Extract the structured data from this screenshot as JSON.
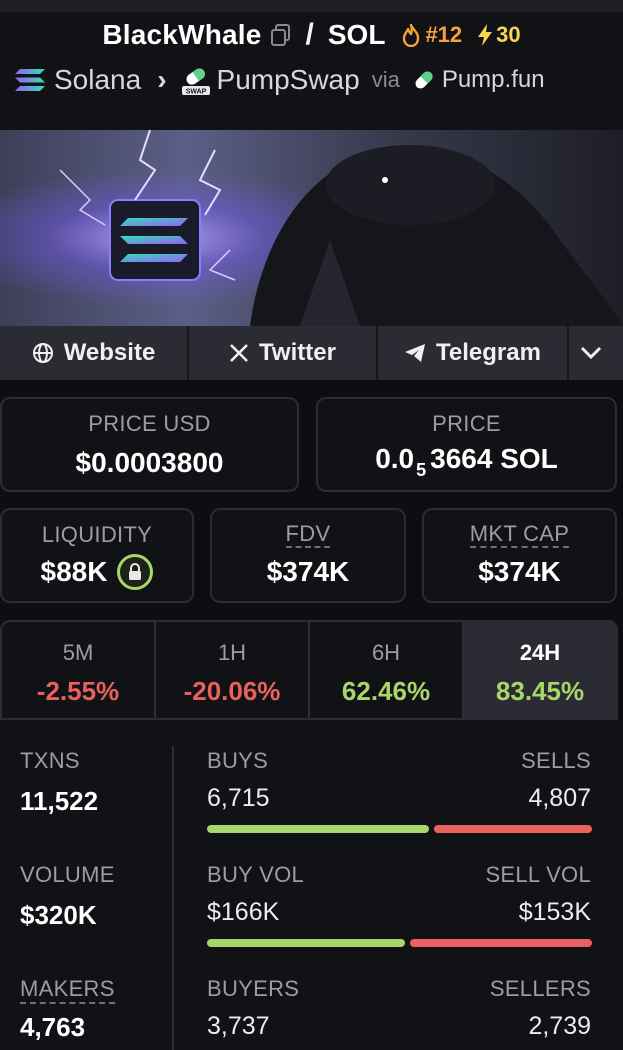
{
  "header": {
    "base_token": "BlackWhale",
    "separator": "/",
    "quote_token": "SOL",
    "rank": "#12",
    "boosts": "30",
    "chain": "Solana",
    "dex": "PumpSwap",
    "via_label": "via",
    "launchpad": "Pump.fun",
    "icons": [
      "copy-icon",
      "fire-icon",
      "lightning-icon",
      "solana-logo",
      "pumpswap-logo",
      "pill-icon"
    ]
  },
  "links": {
    "website": "Website",
    "twitter": "Twitter",
    "telegram": "Telegram"
  },
  "prices": {
    "price_usd_label": "PRICE USD",
    "price_usd": "$0.0003800",
    "price_label": "PRICE",
    "price_native_prefix": "0.0",
    "price_native_zeros": "5",
    "price_native_digits": "3664 SOL"
  },
  "metrics": {
    "liquidity_label": "LIQUIDITY",
    "liquidity": "$88K",
    "fdv_label": "FDV",
    "fdv": "$374K",
    "mcap_label": "MKT CAP",
    "mcap": "$374K"
  },
  "timeframes": [
    {
      "label": "5M",
      "change": "-2.55%"
    },
    {
      "label": "1H",
      "change": "-20.06%"
    },
    {
      "label": "6H",
      "change": "62.46%"
    },
    {
      "label": "24H",
      "change": "83.45%"
    }
  ],
  "stats": {
    "txns_label": "TXNS",
    "txns": "11,522",
    "buys_label": "BUYS",
    "buys": "6,715",
    "sells_label": "SELLS",
    "sells": "4,807",
    "buys_fraction": 0.583,
    "volume_label": "VOLUME",
    "volume": "$320K",
    "buy_vol_label": "BUY VOL",
    "buy_vol": "$166K",
    "sell_vol_label": "SELL VOL",
    "sell_vol": "$153K",
    "buy_vol_fraction": 0.52,
    "makers_label": "MAKERS",
    "makers": "4,763",
    "buyers_label": "BUYERS",
    "buyers": "3,737",
    "sellers_label": "SELLERS",
    "sellers": "2,739"
  },
  "colors": {
    "positive": "#a9d66a",
    "negative": "#e8615c",
    "rank": "#f6a23a",
    "boost": "#f9d64a"
  }
}
